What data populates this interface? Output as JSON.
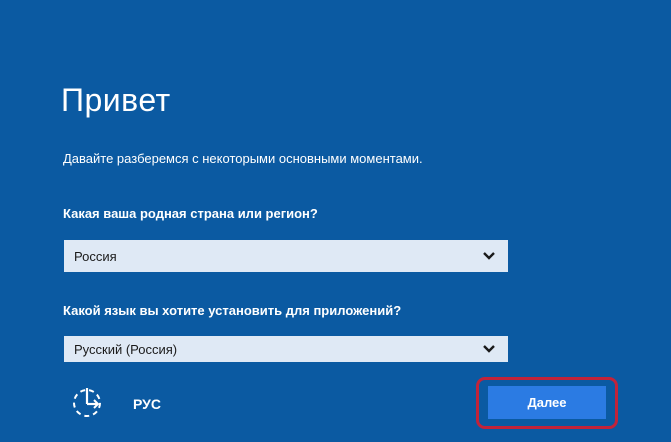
{
  "oobe": {
    "title": "Привет",
    "subtitle": "Давайте разберемся с некоторыми основными моментами.",
    "country": {
      "label": "Какая ваша родная страна или регион?",
      "value": "Россия"
    },
    "language": {
      "label": "Какой язык вы хотите установить для приложений?",
      "value": "Русский (Россия)"
    },
    "footer": {
      "accessibility_icon": "ease-of-access-icon",
      "input_language": "РУС",
      "next_label": "Далее"
    }
  },
  "colors": {
    "background": "#0b5aa2",
    "select_background": "#dfe9f5",
    "button": "#2b7be3",
    "highlight_border": "#c2233a"
  }
}
